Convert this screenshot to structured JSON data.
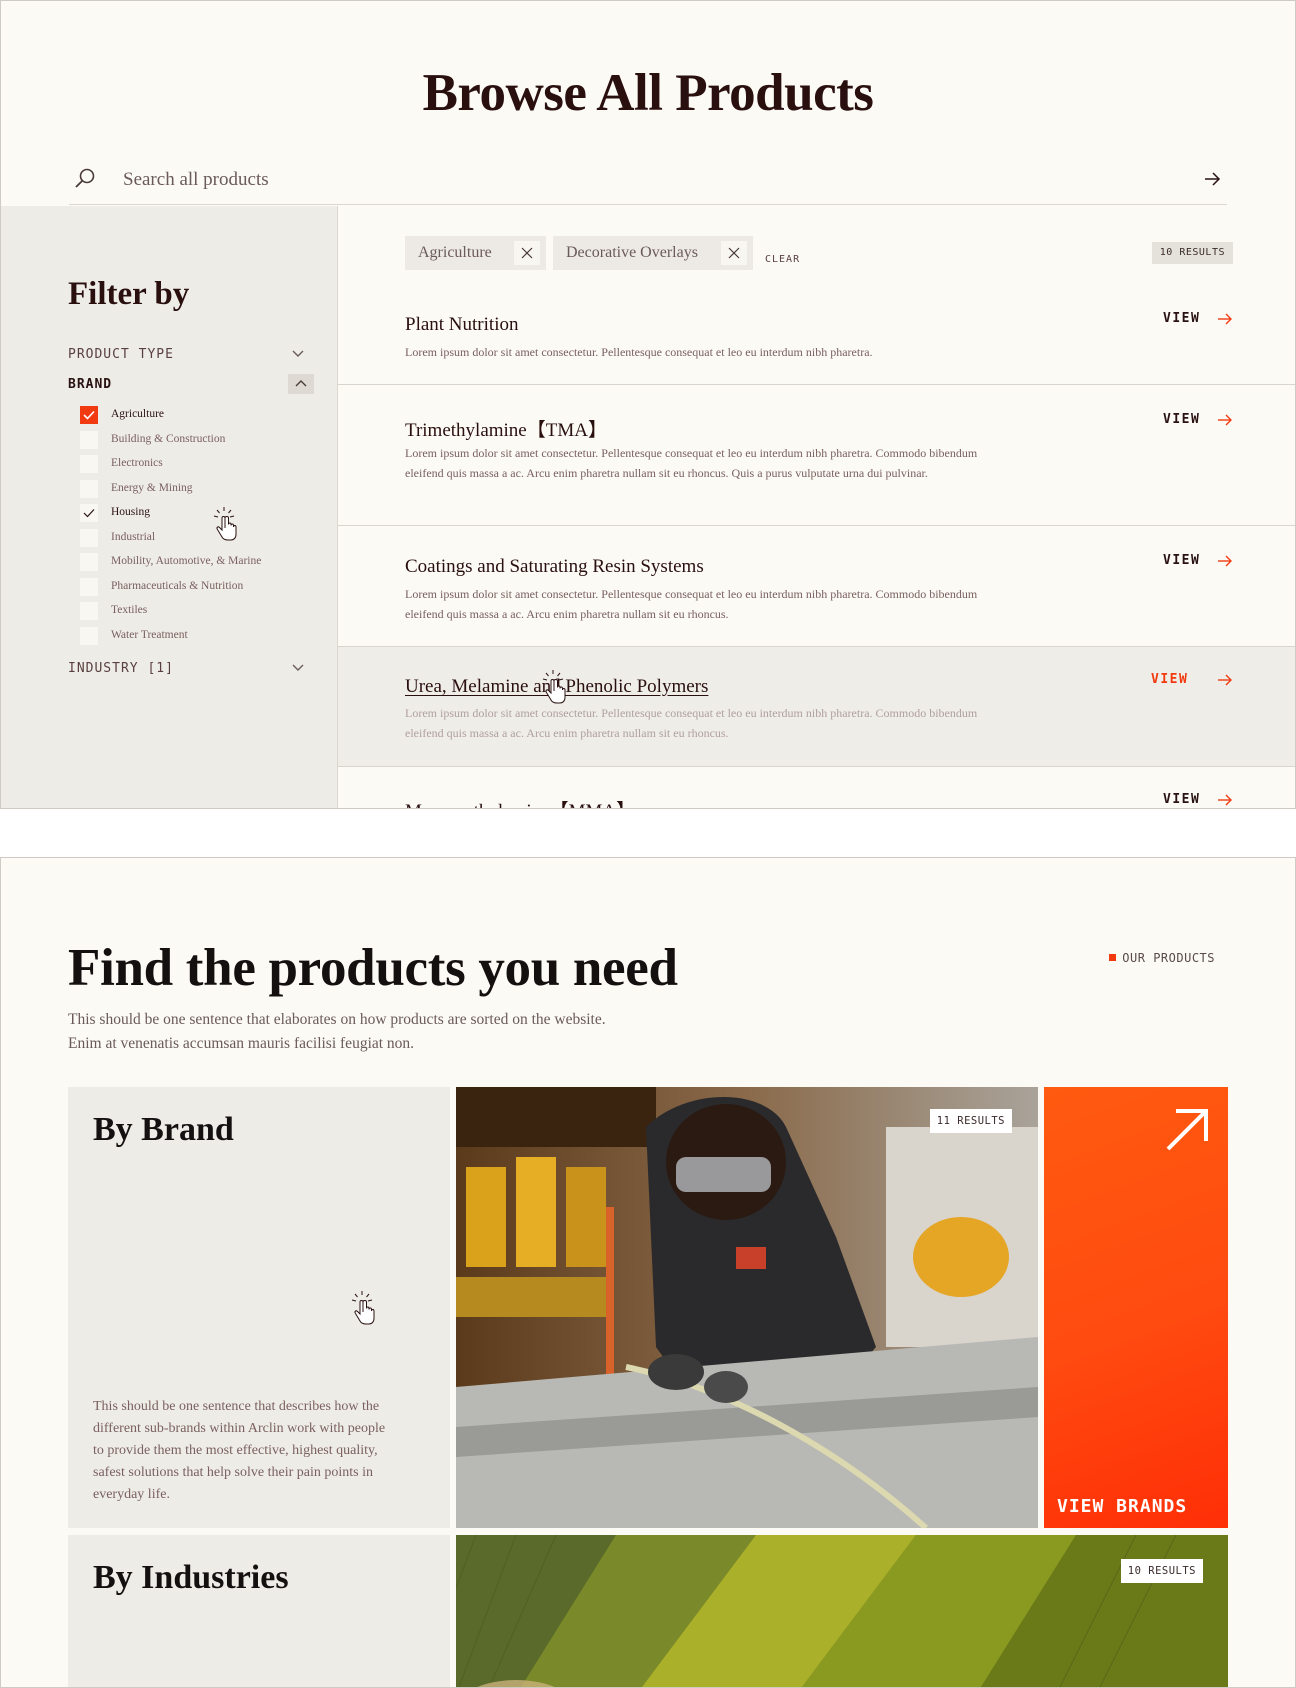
{
  "browse": {
    "title": "Browse All Products",
    "search_placeholder": "Search all products",
    "filter_title": "Filter by",
    "filter_groups": {
      "product_type": "PRODUCT TYPE",
      "brand": "BRAND",
      "industry": "INDUSTRY [1]"
    },
    "brand_options": [
      {
        "label": "Agriculture",
        "checked": true
      },
      {
        "label": "Building & Construction",
        "checked": false
      },
      {
        "label": "Electronics",
        "checked": false
      },
      {
        "label": "Energy & Mining",
        "checked": false
      },
      {
        "label": "Housing",
        "checked": true
      },
      {
        "label": "Industrial",
        "checked": false
      },
      {
        "label": "Mobility, Automotive, & Marine",
        "checked": false
      },
      {
        "label": "Pharmaceuticals & Nutrition",
        "checked": false
      },
      {
        "label": "Textiles",
        "checked": false
      },
      {
        "label": "Water Treatment",
        "checked": false
      }
    ],
    "active_filters": [
      "Agriculture",
      "Decorative Overlays"
    ],
    "clear_label": "CLEAR",
    "results_count": "10 RESULTS",
    "view_label": "VIEW",
    "products": [
      {
        "title": "Plant Nutrition",
        "desc": "Lorem ipsum dolor sit amet consectetur. Pellentesque consequat et leo eu interdum nibh pharetra."
      },
      {
        "title": "Trimethylamine【TMA】",
        "desc": "Lorem ipsum dolor sit amet consectetur. Pellentesque consequat et leo eu interdum nibh pharetra. Commodo bibendum eleifend quis massa a ac. Arcu enim pharetra nullam sit eu rhoncus. Quis a purus vulputate urna dui pulvinar."
      },
      {
        "title": "Coatings and Saturating Resin Systems",
        "desc": "Lorem ipsum dolor sit amet consectetur. Pellentesque consequat et leo eu interdum nibh pharetra. Commodo bibendum eleifend quis massa a ac. Arcu enim pharetra nullam sit eu rhoncus."
      },
      {
        "title": "Urea, Melamine and Phenolic Polymers",
        "desc": "Lorem ipsum dolor sit amet consectetur. Pellentesque consequat et leo eu interdum nibh pharetra. Commodo bibendum eleifend quis massa a ac. Arcu enim pharetra nullam sit eu rhoncus."
      },
      {
        "title": "Monomethylamine【MMA】",
        "desc": ""
      }
    ]
  },
  "find": {
    "title": "Find the products you need",
    "description": "This should be one sentence that elaborates on how products are sorted on the website. Enim at venenatis accumsan mauris facilisi feugiat non.",
    "tag": "OUR PRODUCTS",
    "by_brand": {
      "title": "By Brand",
      "description": "This should be one sentence that describes how the different sub-brands within Arclin work with people to provide them the most effective, highest quality, safest solutions that help solve their pain points in everyday life.",
      "results": "11 RESULTS",
      "cta": "VIEW BRANDS"
    },
    "by_industries": {
      "title": "By Industries",
      "results": "10 RESULTS"
    }
  },
  "colors": {
    "accent": "#f23a10",
    "background": "#fbfaf5",
    "panel": "#eeece7",
    "ink": "#2a0f0f"
  }
}
